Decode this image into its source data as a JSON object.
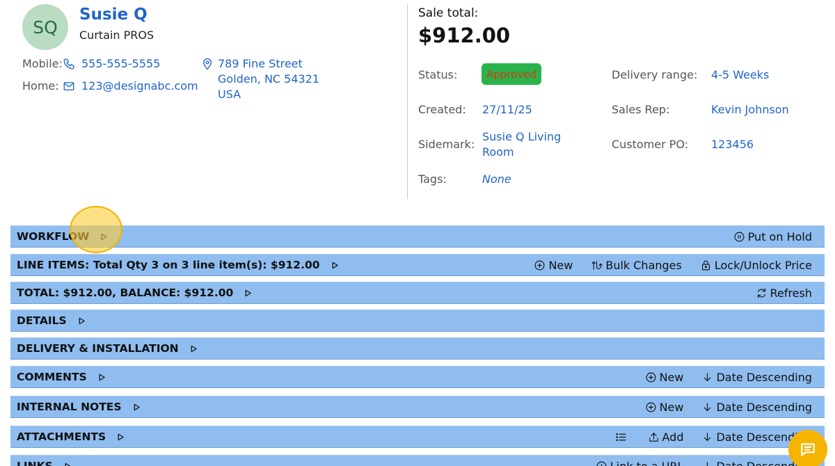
{
  "customer": {
    "initials": "SQ",
    "name": "Susie Q",
    "company": "Curtain PROS",
    "mobile_label": "Mobile:",
    "mobile": "555-555-5555",
    "home_label": "Home:",
    "email": "123@designabc.com",
    "address_line1": "789 Fine Street",
    "address_line2": "Golden, NC 54321",
    "address_line3": "USA"
  },
  "sale": {
    "total_label": "Sale total:",
    "total": "$912.00",
    "status_label": "Status:",
    "status": "Approved",
    "created_label": "Created:",
    "created": "27/11/25",
    "sidemark_label": "Sidemark:",
    "sidemark_line1": "Susie Q Living",
    "sidemark_line2": "Room",
    "tags_label": "Tags:",
    "tags": "None",
    "delivery_label": "Delivery range:",
    "delivery": "4-5 Weeks",
    "rep_label": "Sales Rep:",
    "rep": "Kevin Johnson",
    "po_label": "Customer PO:",
    "po": "123456"
  },
  "sections": {
    "workflow": {
      "title": "WORKFLOW",
      "hold": "Put on Hold"
    },
    "line_items": {
      "title": "LINE ITEMS: Total Qty 3 on 3 line item(s): $912.00",
      "new": "New",
      "bulk": "Bulk Changes",
      "lock": "Lock/Unlock Price"
    },
    "total": {
      "title": "TOTAL: $912.00, BALANCE: $912.00",
      "refresh": "Refresh"
    },
    "details": {
      "title": "DETAILS"
    },
    "delivery": {
      "title": "DELIVERY & INSTALLATION"
    },
    "comments": {
      "title": "COMMENTS",
      "new": "New",
      "sort": "Date Descending"
    },
    "internal_notes": {
      "title": "INTERNAL NOTES",
      "new": "New",
      "sort": "Date Descending"
    },
    "attachments": {
      "title": "ATTACHMENTS",
      "add": "Add",
      "sort": "Date Descending"
    },
    "links": {
      "title": "LINKS",
      "link_url": "Link to a URL",
      "sort": "Date Descending"
    }
  },
  "icons": {
    "phone": "phone-icon",
    "mail": "mail-icon",
    "location": "location-pin-icon",
    "chevron": "chevron-right-icon",
    "pause": "pause-circle-icon",
    "plus": "plus-circle-icon",
    "bulk": "bulk-changes-icon",
    "lock": "lock-icon",
    "refresh": "refresh-icon",
    "sort": "arrow-down-icon",
    "list": "list-icon",
    "upload": "upload-icon",
    "chat": "chat-icon"
  },
  "colors": {
    "section_bar": "#8fbdef",
    "link": "#1f64c8",
    "status_bg": "#2ab34a",
    "status_text": "#d43a1a",
    "chat_button": "#f5b400",
    "highlight": "#ffcc33"
  }
}
